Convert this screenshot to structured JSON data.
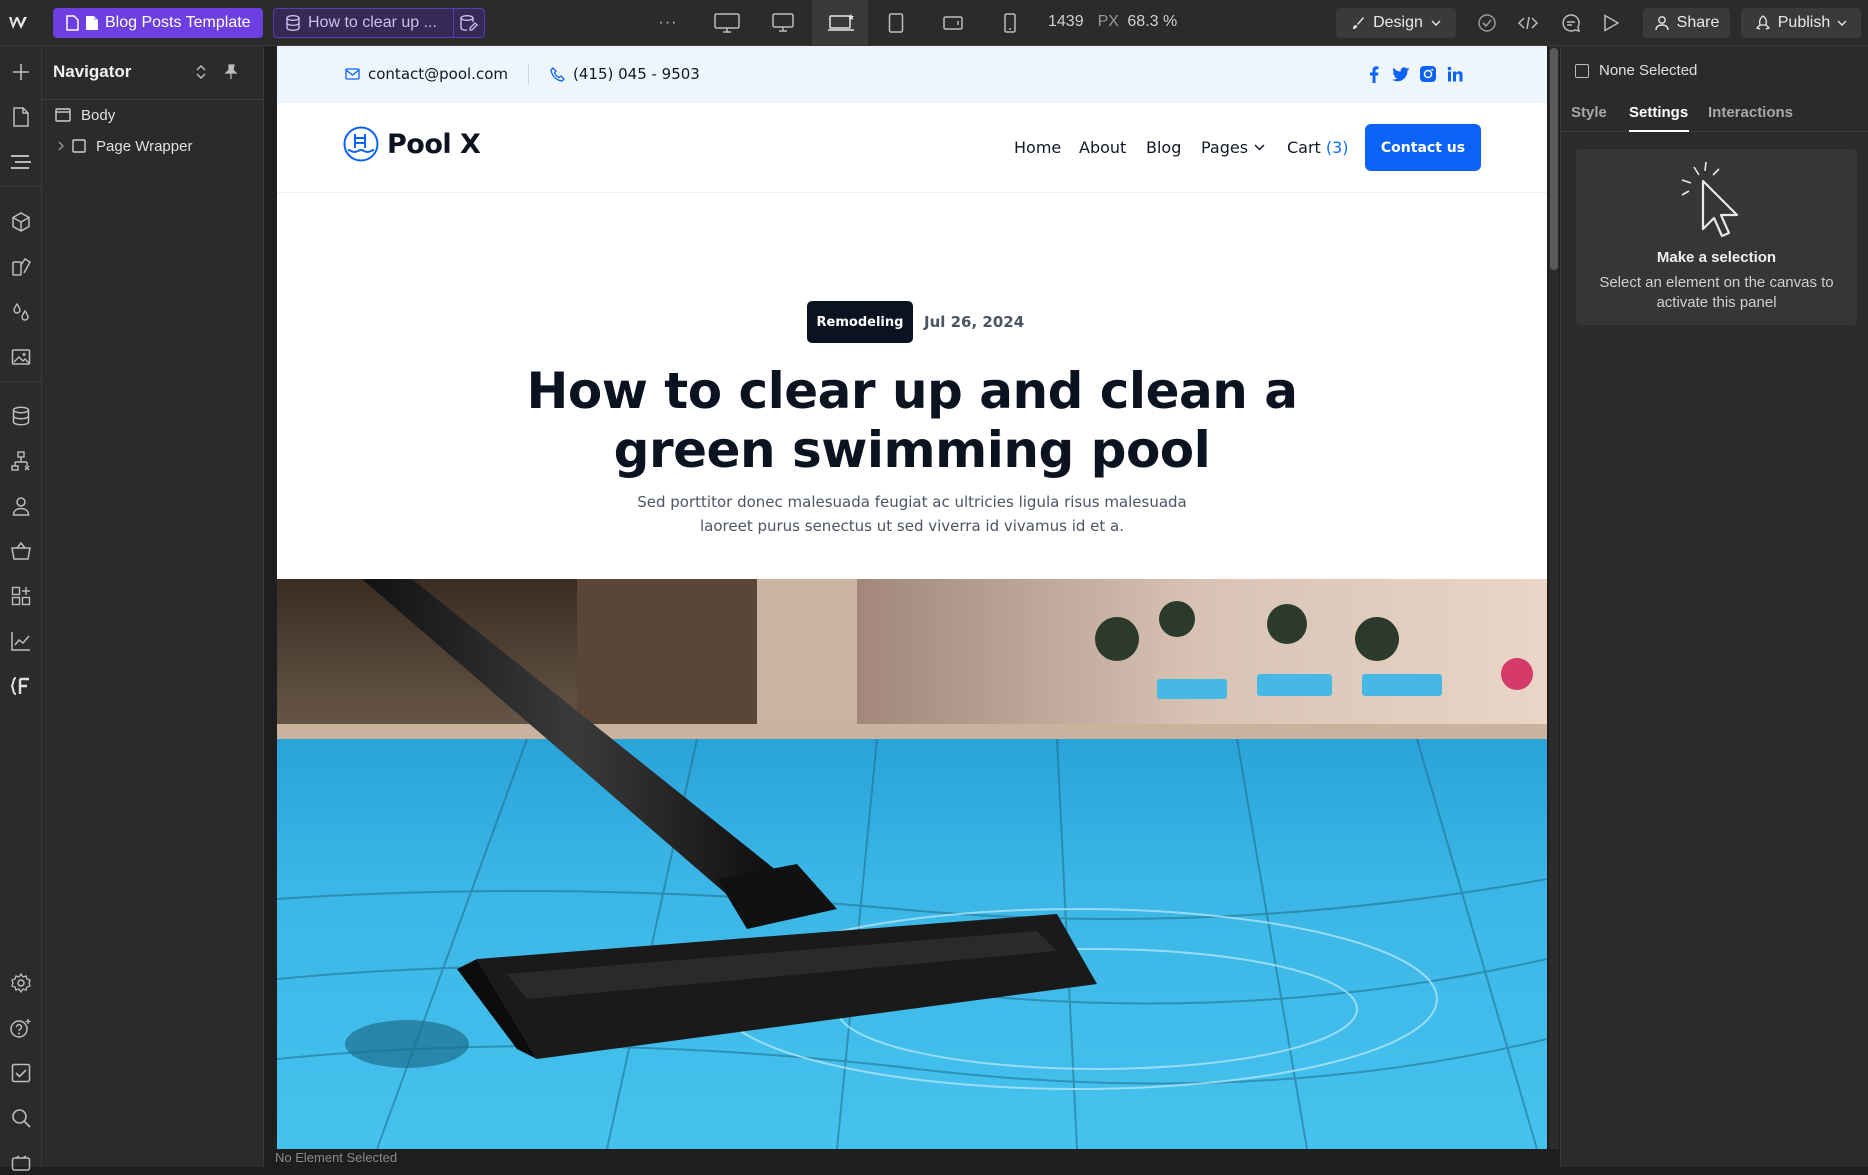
{
  "toolbar": {
    "template_label": "Blog Posts Template",
    "collection_item_label": "How to clear up ...",
    "more_label": "···",
    "width_value": "1439",
    "width_unit": "PX",
    "zoom_value": "68.3 %",
    "design_label": "Design",
    "share_label": "Share",
    "publish_label": "Publish"
  },
  "navigator": {
    "title": "Navigator",
    "items": [
      {
        "label": "Body"
      },
      {
        "label": "Page Wrapper"
      }
    ]
  },
  "canvas": {
    "status_text": "No Element Selected"
  },
  "site": {
    "email": "contact@pool.com",
    "phone": "(415) 045 - 9503",
    "brand": "Pool X",
    "nav": {
      "home": "Home",
      "about": "About",
      "blog": "Blog",
      "pages": "Pages",
      "cart": "Cart",
      "cart_count": "(3)"
    },
    "contact_button": "Contact us",
    "post": {
      "category": "Remodeling",
      "date": "Jul 26, 2024",
      "title": "How to clear up and clean a green swimming pool",
      "subtitle": "Sed porttitor donec malesuada feugiat ac ultricies ligula risus malesuada laoreet purus senectus ut sed viverra id vivamus id et a."
    },
    "accent_color": "#0b63f6"
  },
  "settings_panel": {
    "selection_label": "None Selected",
    "tabs": [
      "Style",
      "Settings",
      "Interactions"
    ],
    "active_tab": "Settings",
    "empty_title": "Make a selection",
    "empty_text": "Select an element on the canvas to activate this panel"
  }
}
